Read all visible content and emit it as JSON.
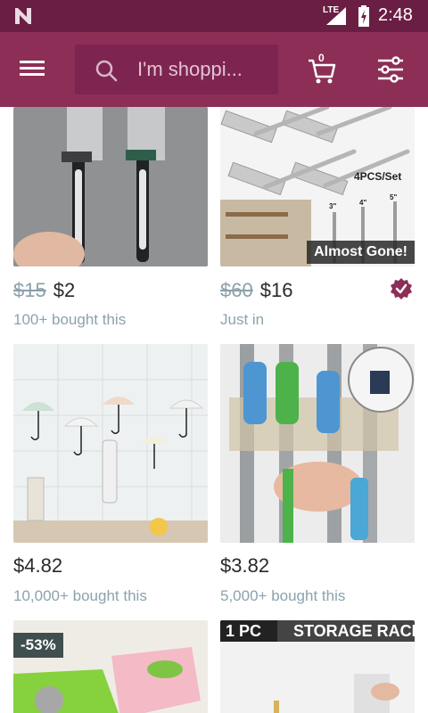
{
  "status_bar": {
    "network": "LTE",
    "time": "2:48"
  },
  "search": {
    "placeholder": "I'm shoppi..."
  },
  "cart": {
    "count": "0"
  },
  "colors": {
    "status_bar": "#6b1e43",
    "app_bar": "#8c2e56",
    "accent": "#8c2e56"
  },
  "icons": [
    "n-logo-icon",
    "signal-icon",
    "battery-icon",
    "menu-icon",
    "search-icon",
    "cart-icon",
    "filter-icon",
    "verified-check-icon"
  ],
  "products": [
    {
      "old_price": "$15",
      "price": "$2",
      "bought": "100+ bought this"
    },
    {
      "old_price": "$60",
      "price": "$16",
      "bought": "Just in",
      "badge": "Almost Gone!",
      "image_text": "4PCS/Set",
      "sizes": [
        "3\"",
        "4\"",
        "5\""
      ]
    },
    {
      "old_price": "",
      "price": "$4.82",
      "bought": "10,000+ bought this"
    },
    {
      "old_price": "",
      "price": "$3.82",
      "bought": "5,000+ bought this"
    },
    {
      "discount": "-53%"
    },
    {
      "banner_left": "1 PC",
      "banner_right": "STORAGE RACK"
    }
  ]
}
